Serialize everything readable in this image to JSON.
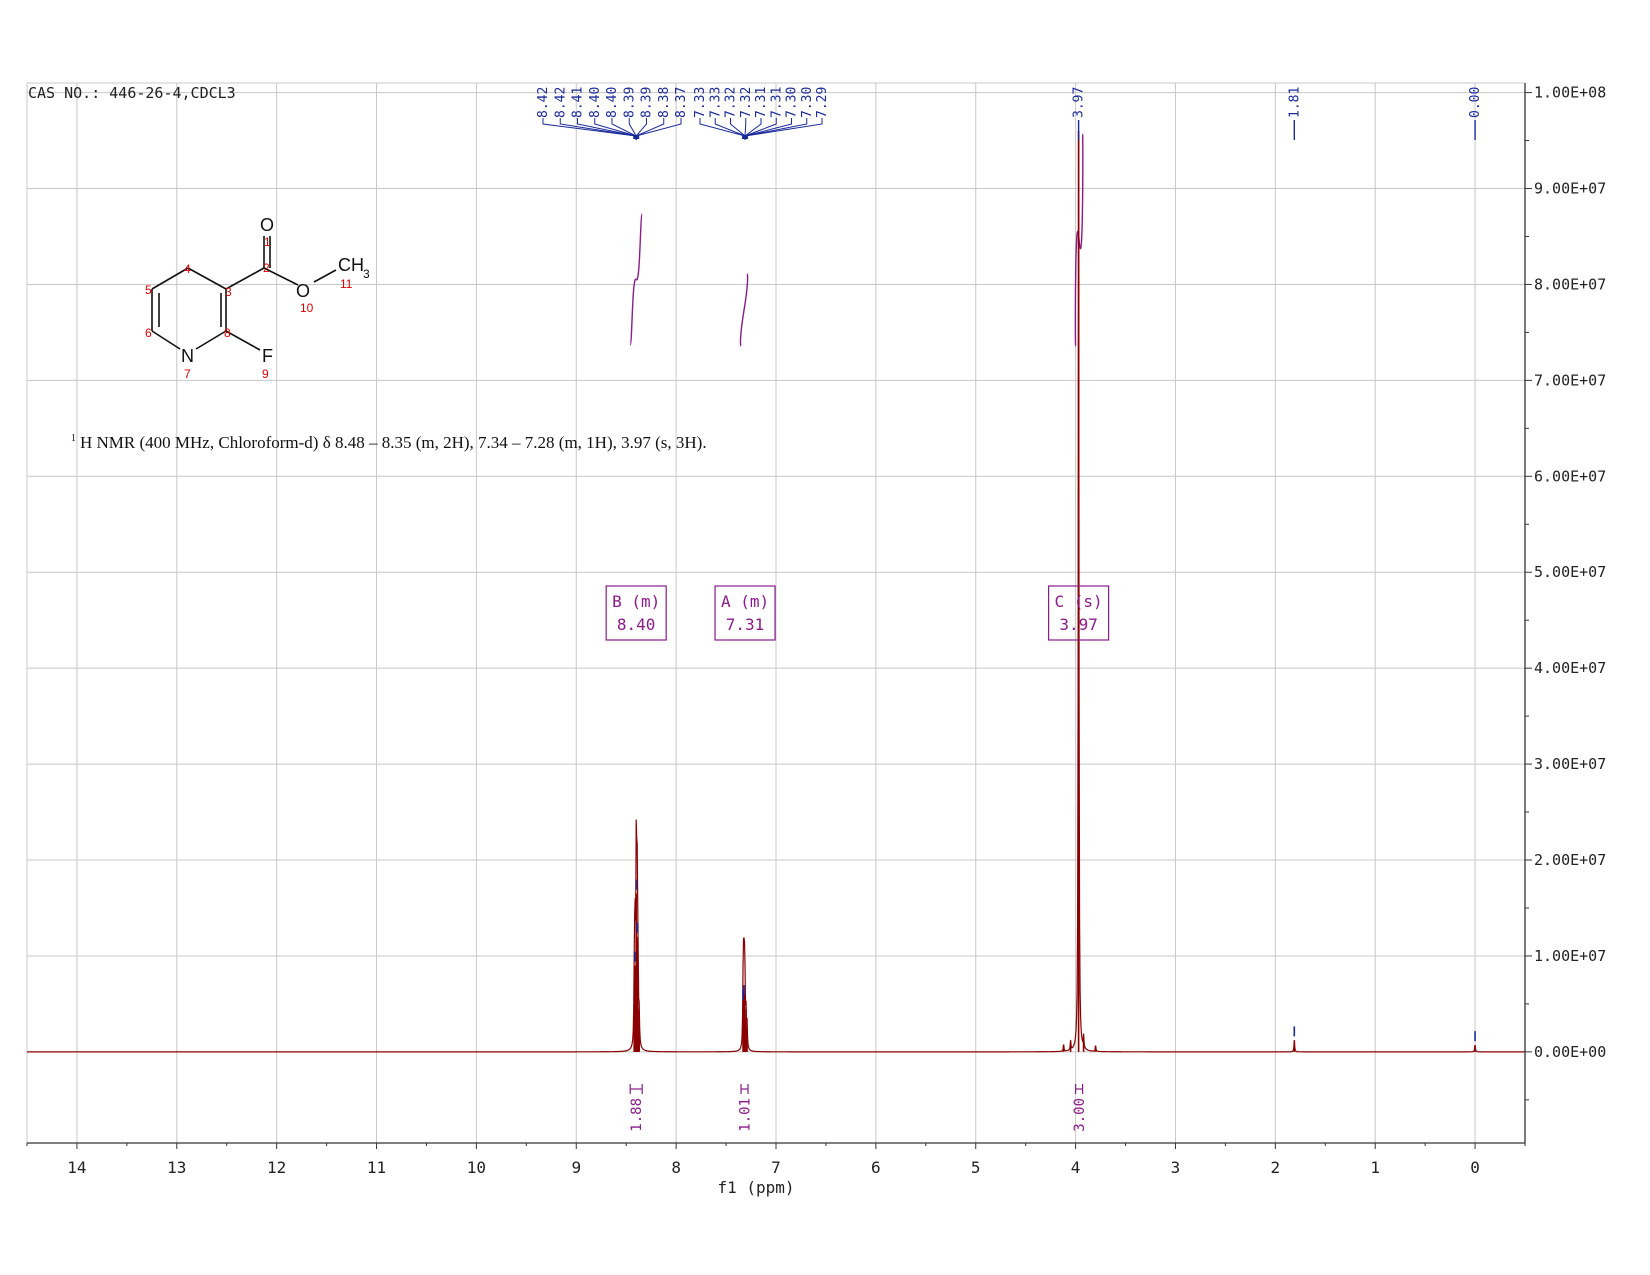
{
  "header": {
    "cas_label": "CAS NO.: 446-26-4,CDCL3"
  },
  "description": {
    "superscript": "1",
    "text": "H NMR (400 MHz, Chloroform-d) δ 8.48 – 8.35 (m, 2H), 7.34 – 7.28 (m, 1H), 3.97 (s, 3H)."
  },
  "structure": {
    "atoms": [
      "O",
      "O",
      "CH",
      "3",
      "N",
      "F"
    ],
    "numbers": [
      "1",
      "2",
      "3",
      "4",
      "5",
      "6",
      "7",
      "8",
      "9",
      "10",
      "11"
    ]
  },
  "colors": {
    "spectrum": "#8b0000",
    "integral": "#8b1a8b",
    "peak_label": "#1a2a9a",
    "grid": "#c8c8c8",
    "atom_number": "#e00000"
  },
  "chart_data": {
    "type": "line",
    "title": "",
    "xlabel": "f1 (ppm)",
    "ylabel": "",
    "x_reversed": true,
    "xlim": [
      14.5,
      -0.5
    ],
    "ylim": [
      -9500000,
      101000000
    ],
    "grid": true,
    "x_ticks": [
      "14",
      "13",
      "12",
      "11",
      "10",
      "9",
      "8",
      "7",
      "6",
      "5",
      "4",
      "3",
      "2",
      "1",
      "0"
    ],
    "x_tick_values": [
      14,
      13,
      12,
      11,
      10,
      9,
      8,
      7,
      6,
      5,
      4,
      3,
      2,
      1,
      0
    ],
    "y_ticks": [
      "1.00E+08",
      "9.00E+07",
      "8.00E+07",
      "7.00E+07",
      "6.00E+07",
      "5.00E+07",
      "4.00E+07",
      "3.00E+07",
      "2.00E+07",
      "1.00E+07",
      "0.00E+00"
    ],
    "y_tick_values": [
      100000000,
      90000000,
      80000000,
      70000000,
      60000000,
      50000000,
      40000000,
      30000000,
      20000000,
      10000000,
      0
    ],
    "peaks": [
      {
        "ppm": 8.42,
        "height": 5000000
      },
      {
        "ppm": 8.415,
        "height": 7000000
      },
      {
        "ppm": 8.41,
        "height": 9000000
      },
      {
        "ppm": 8.4,
        "height": 16500000
      },
      {
        "ppm": 8.395,
        "height": 9000000
      },
      {
        "ppm": 8.39,
        "height": 12000000
      },
      {
        "ppm": 8.385,
        "height": 6500000
      },
      {
        "ppm": 8.38,
        "height": 4500000
      },
      {
        "ppm": 8.37,
        "height": 3000000
      },
      {
        "ppm": 7.33,
        "height": 5000000
      },
      {
        "ppm": 7.325,
        "height": 6500000
      },
      {
        "ppm": 7.32,
        "height": 5500000
      },
      {
        "ppm": 7.315,
        "height": 6000000
      },
      {
        "ppm": 7.31,
        "height": 4500000
      },
      {
        "ppm": 7.3,
        "height": 3500000
      },
      {
        "ppm": 7.29,
        "height": 2500000
      },
      {
        "ppm": 4.12,
        "height": 700000
      },
      {
        "ppm": 4.05,
        "height": 1000000
      },
      {
        "ppm": 3.97,
        "height": 96000000
      },
      {
        "ppm": 3.92,
        "height": 1300000
      },
      {
        "ppm": 3.8,
        "height": 600000
      },
      {
        "ppm": 1.81,
        "height": 1200000
      },
      {
        "ppm": 0.0,
        "height": 700000
      }
    ],
    "peak_labels_group1": [
      "8.42",
      "8.42",
      "8.41",
      "8.40",
      "8.40",
      "8.39",
      "8.39",
      "8.38",
      "8.37"
    ],
    "peak_labels_group2": [
      "7.33",
      "7.33",
      "7.32",
      "7.32",
      "7.31",
      "7.31",
      "7.30",
      "7.30",
      "7.29"
    ],
    "peak_labels_single": [
      {
        "label": "3.97",
        "ppm": 3.97
      },
      {
        "label": "1.81",
        "ppm": 1.81
      },
      {
        "label": "0.00",
        "ppm": 0.0
      }
    ],
    "multiplets": [
      {
        "letter": "B (m)",
        "shift": "8.40",
        "ppm": 8.4
      },
      {
        "letter": "A (m)",
        "shift": "7.31",
        "ppm": 7.31
      },
      {
        "letter": "C (s)",
        "shift": "3.97",
        "ppm": 3.97
      }
    ],
    "integrations": [
      {
        "value": "1.88",
        "from": 8.46,
        "to": 8.34
      },
      {
        "value": "1.01",
        "from": 7.35,
        "to": 7.28
      },
      {
        "value": "3.00",
        "from": 4.0,
        "to": 3.93
      }
    ]
  }
}
